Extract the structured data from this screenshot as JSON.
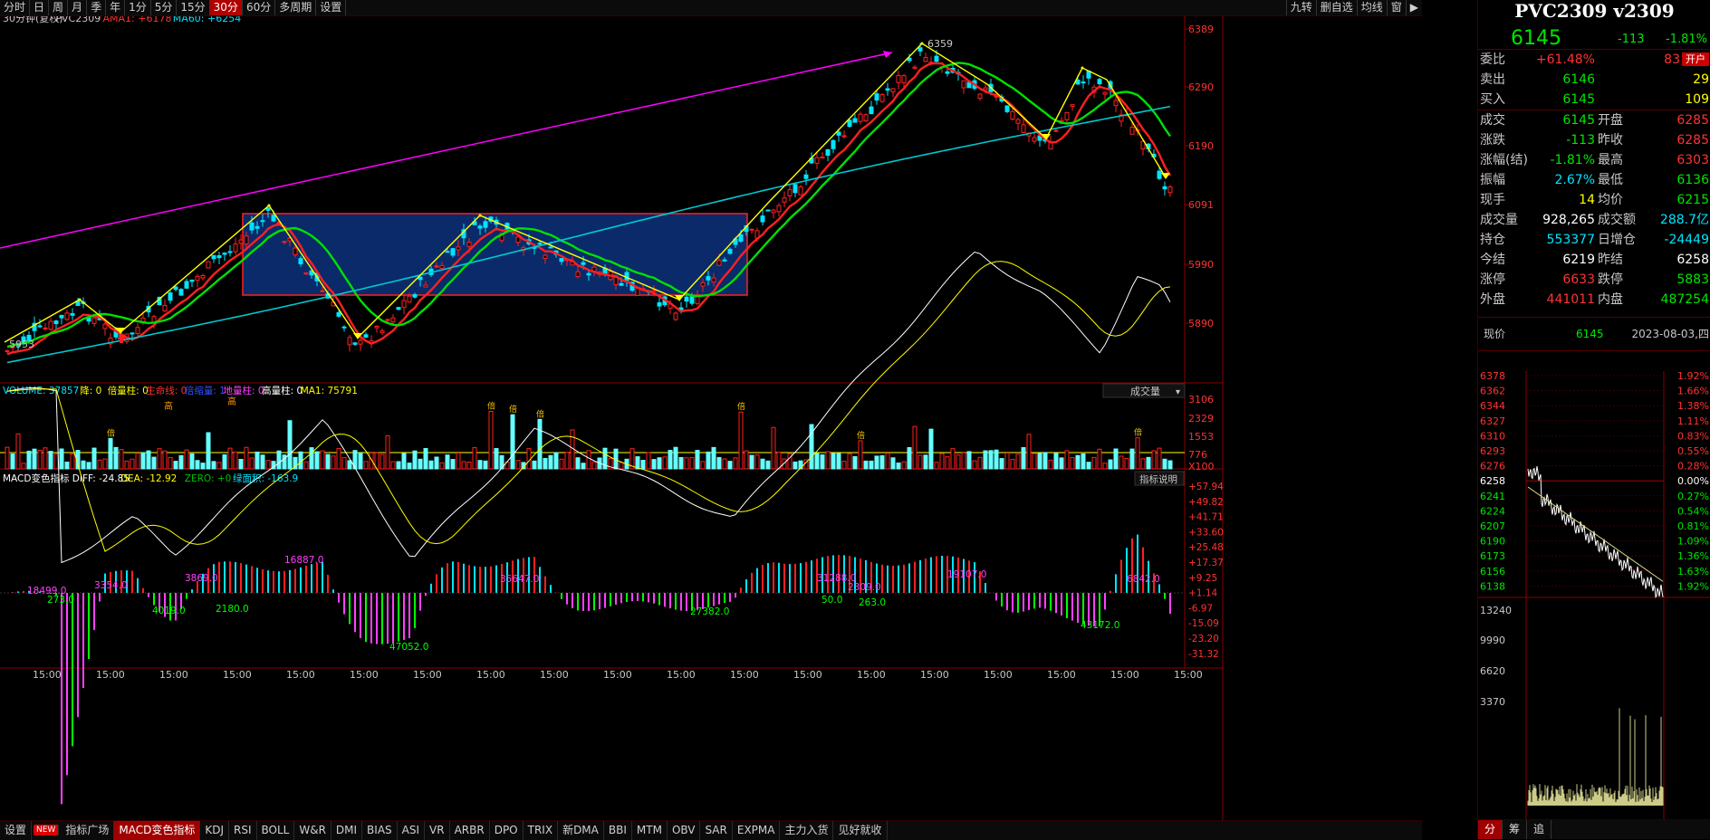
{
  "toolbar": {
    "tabs": [
      "分时",
      "日",
      "周",
      "月",
      "季",
      "年",
      "1分",
      "5分",
      "15分",
      "30分",
      "60分",
      "多周期",
      "设置"
    ],
    "active_tab": "30分",
    "right_buttons": [
      "九转",
      "删自选",
      "均线",
      "窗"
    ]
  },
  "main_chart": {
    "legend_prefix": "30分钟(复权)",
    "symbol": "PVC2309",
    "ama_label": "AMA1: +6178",
    "ma_label": "MA60: +6254",
    "y_ticks": [
      "6389",
      "6290",
      "6190",
      "6091",
      "5990",
      "5890"
    ],
    "peak_label": "6359",
    "low_label": "5953",
    "colors": {
      "ama": "#ff2020",
      "ma20": "#00e000",
      "ma60": "#00c8d0",
      "zigzag": "#ffff00",
      "trend": "#ff00ff",
      "box_fill": "#0a2a6a",
      "box_border": "#ff2020"
    }
  },
  "volume": {
    "legend": [
      {
        "text": "VOLUME: 37857",
        "color": "#00e5ff"
      },
      {
        "text": "降: 0",
        "color": "#ffff00"
      },
      {
        "text": "倍量柱: 0",
        "color": "#ffff00"
      },
      {
        "text": "生命线: 0",
        "color": "#ff3333"
      },
      {
        "text": "倍缩量: 1",
        "color": "#3050ff"
      },
      {
        "text": "地量柱: 0",
        "color": "#ff40ff"
      },
      {
        "text": "高量柱: 0",
        "color": "#ffffff"
      },
      {
        "text": "MA1: 75791",
        "color": "#ffff00"
      }
    ],
    "dropdown": "成交量",
    "y_ticks": [
      "3106",
      "2329",
      "1553",
      "776",
      "X100"
    ],
    "mark_gao": "高",
    "mark_bei": "倍"
  },
  "macd": {
    "legend": [
      {
        "text": "MACD变色指标 DIFF: -24.85",
        "color": "#ffffff"
      },
      {
        "text": "DEA: -12.92",
        "color": "#ffff00"
      },
      {
        "text": "ZERO: +0",
        "color": "#00c000"
      },
      {
        "text": "绿面积: -163.9",
        "color": "#00e5ff"
      }
    ],
    "help_button": "指标说明",
    "y_ticks": [
      "+57.94",
      "+49.82",
      "+41.71",
      "+33.60",
      "+25.48",
      "+17.37",
      "+9.25",
      "+1.14",
      "-6.97",
      "-15.09",
      "-23.20",
      "-31.32"
    ],
    "area_labels": [
      {
        "t": "18499.0",
        "c": "#ff40ff"
      },
      {
        "t": "273.0",
        "c": "#00ff00"
      },
      {
        "t": "3354.0",
        "c": "#ff40ff"
      },
      {
        "t": "4019.0",
        "c": "#00ff00"
      },
      {
        "t": "3869.0",
        "c": "#ff40ff"
      },
      {
        "t": "2180.0",
        "c": "#00ff00"
      },
      {
        "t": "16887.0",
        "c": "#ff40ff"
      },
      {
        "t": "47052.0",
        "c": "#00ff00"
      },
      {
        "t": "35647.0",
        "c": "#ff40ff"
      },
      {
        "t": "27382.0",
        "c": "#00ff00"
      },
      {
        "t": "31288.0",
        "c": "#ff40ff"
      },
      {
        "t": "50.0",
        "c": "#00ff00"
      },
      {
        "t": "2309.0",
        "c": "#ff40ff"
      },
      {
        "t": "263.0",
        "c": "#00ff00"
      },
      {
        "t": "19107.0",
        "c": "#ff40ff"
      },
      {
        "t": "43172.0",
        "c": "#00ff00"
      },
      {
        "t": "6842.0",
        "c": "#ff40ff"
      }
    ]
  },
  "time_axis": [
    "15:00",
    "15:00",
    "15:00",
    "15:00",
    "15:00",
    "15:00",
    "15:00",
    "15:00",
    "15:00",
    "15:00",
    "15:00",
    "15:00",
    "15:00",
    "15:00",
    "15:00",
    "15:00",
    "15:00",
    "15:00",
    "15:00"
  ],
  "bottom_tabs": [
    "设置",
    "NEW",
    "指标广场",
    "MACD变色指标",
    "KDJ",
    "RSI",
    "BOLL",
    "W&R",
    "DMI",
    "BIAS",
    "ASI",
    "VR",
    "ARBR",
    "DPO",
    "TRIX",
    "新DMA",
    "BBI",
    "MTM",
    "OBV",
    "SAR",
    "EXPMA",
    "主力入货",
    "见好就收"
  ],
  "active_bottom_tab": "MACD变色指标",
  "quote": {
    "title": "PVC2309 v2309",
    "price": "6145",
    "change": "-113",
    "change_pct": "-1.81%",
    "rows": [
      {
        "l": "委比",
        "v": "+61.48%",
        "vc": "red",
        "l2": "83",
        "l2c": "red",
        "v2": "开户",
        "v2c": "badge"
      },
      {
        "l": "卖出",
        "v": "6146",
        "vc": "green",
        "l2": "",
        "v2": "29",
        "v2c": "yellow"
      },
      {
        "l": "买入",
        "v": "6145",
        "vc": "green",
        "l2": "",
        "v2": "109",
        "v2c": "yellow",
        "sep": true
      },
      {
        "l": "成交",
        "v": "6145",
        "vc": "green",
        "l2": "开盘",
        "v2": "6285",
        "v2c": "red"
      },
      {
        "l": "涨跌",
        "v": "-113",
        "vc": "green",
        "l2": "昨收",
        "v2": "6285",
        "v2c": "red"
      },
      {
        "l": "涨幅(结)",
        "v": "-1.81%",
        "vc": "green",
        "l2": "最高",
        "v2": "6303",
        "v2c": "red"
      },
      {
        "l": "振幅",
        "v": "2.67%",
        "vc": "cyan",
        "l2": "最低",
        "v2": "6136",
        "v2c": "green"
      },
      {
        "l": "现手",
        "v": "14",
        "vc": "yellow",
        "l2": "均价",
        "v2": "6215",
        "v2c": "green"
      },
      {
        "l": "成交量",
        "v": "928,265",
        "vc": "white",
        "l2": "成交额",
        "v2": "288.7亿",
        "v2c": "cyan"
      },
      {
        "l": "持仓",
        "v": "553377",
        "vc": "cyan",
        "l2": "日增仓",
        "v2": "-24449",
        "v2c": "cyan"
      },
      {
        "l": "今结",
        "v": "6219",
        "vc": "white",
        "l2": "昨结",
        "v2": "6258",
        "v2c": "white"
      },
      {
        "l": "涨停",
        "v": "6633",
        "vc": "red",
        "l2": "跌停",
        "v2": "5883",
        "v2c": "green"
      },
      {
        "l": "外盘",
        "v": "441011",
        "vc": "red",
        "l2": "内盘",
        "v2": "487254",
        "v2c": "green"
      }
    ],
    "now_label": "现价",
    "now_price": "6145",
    "now_date": "2023-08-03,四",
    "mini_prices": [
      "6378",
      "6362",
      "6344",
      "6327",
      "6310",
      "6293",
      "6276",
      "6258",
      "6241",
      "6224",
      "6207",
      "6190",
      "6173",
      "6156",
      "6138"
    ],
    "mini_pcts": [
      "1.92%",
      "1.66%",
      "1.38%",
      "1.11%",
      "0.83%",
      "0.55%",
      "0.28%",
      "0.00%",
      "0.27%",
      "0.54%",
      "0.81%",
      "1.09%",
      "1.36%",
      "1.63%",
      "1.92%"
    ],
    "mini_vol": [
      "13240",
      "9990",
      "6620",
      "3370"
    ],
    "mini_tabs": [
      "分",
      "筹",
      "追"
    ]
  }
}
